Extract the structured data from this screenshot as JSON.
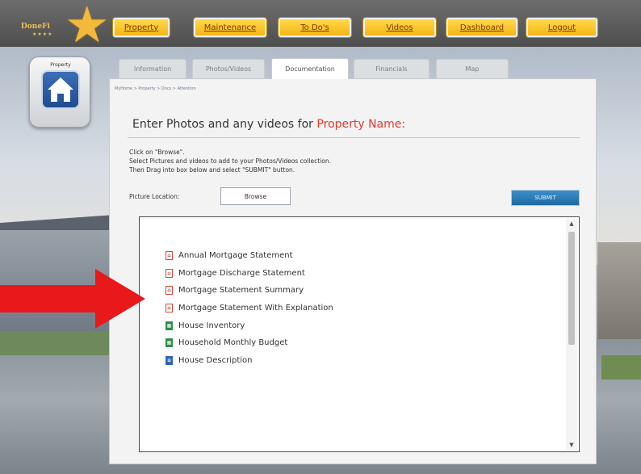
{
  "brand": {
    "logo_text": "DoneFi",
    "logo_stars": "★★★★"
  },
  "nav": {
    "items": [
      {
        "label": "Property"
      },
      {
        "label": "Maintenance"
      },
      {
        "label": "To Do's"
      },
      {
        "label": "Videos"
      },
      {
        "label": "Dashboard"
      },
      {
        "label": "Logout"
      }
    ]
  },
  "property_icon": {
    "label": "Property"
  },
  "tabs": [
    {
      "label": "Information"
    },
    {
      "label": "Photos/Videos"
    },
    {
      "label": "Documentation"
    },
    {
      "label": "Financials"
    },
    {
      "label": "Map"
    }
  ],
  "main": {
    "breadcrumb": "MyHome > Property > Docs > Attention",
    "heading_prefix": "Enter Photos and any videos for ",
    "heading_highlight": "Property Name:",
    "instructions": [
      "Click on \"Browse\".",
      "Select Pictures and videos to add to your Photos/Videos collection.",
      "Then Drag into box below and select \"SUBMIT\" button."
    ],
    "picture_location_label": "Picture Location:",
    "browse_label": "Browse",
    "submit_label": "SUBMIT"
  },
  "files": [
    {
      "name": "Annual Mortgage Statement",
      "type": "pdf",
      "icon": "pdf-file-icon"
    },
    {
      "name": "Mortgage Discharge Statement",
      "type": "pdf",
      "icon": "pdf-file-icon"
    },
    {
      "name": "Mortgage Statement Summary",
      "type": "pdf",
      "icon": "pdf-file-icon"
    },
    {
      "name": "Mortgage Statement With Explanation",
      "type": "pdf",
      "icon": "pdf-file-icon"
    },
    {
      "name": "House Inventory",
      "type": "xls",
      "icon": "spreadsheet-file-icon"
    },
    {
      "name": "Household Monthly Budget",
      "type": "xls",
      "icon": "spreadsheet-file-icon"
    },
    {
      "name": "House Description",
      "type": "doc",
      "icon": "word-file-icon"
    }
  ],
  "colors": {
    "accent": "#f5b514",
    "highlight": "#e23a2f",
    "submit": "#1e6aa3",
    "arrow": "#e8191b"
  }
}
